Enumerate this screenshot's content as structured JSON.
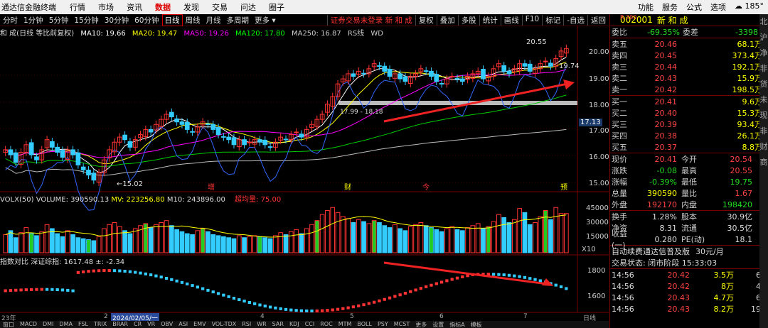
{
  "topbar": {
    "app": "通达信金融终端",
    "menu": [
      "行情",
      "市场",
      "资讯",
      "数据",
      "发现",
      "交易",
      "问达",
      "圈子"
    ],
    "active": "数据",
    "right": [
      "功能",
      "服务",
      "公式",
      "选项"
    ],
    "badge": "185°"
  },
  "periods": [
    "分时",
    "1分钟",
    "5分钟",
    "15分钟",
    "30分钟",
    "60分钟",
    "日线",
    "周线",
    "月线",
    "多周期",
    "更多"
  ],
  "active_period": "日线",
  "login_text": "证券交易未登录",
  "stock_name_top": "新 和 成",
  "tools": [
    "复权",
    "叠加",
    "多股",
    "统计",
    "画线",
    "F10",
    "标记",
    "-自选",
    "返回"
  ],
  "mainline": {
    "title": "和 成(日线 等比前复权)",
    "ma": [
      {
        "label": "MA10: 19.66",
        "color": "#ffffff"
      },
      {
        "label": "MA20: 19.47",
        "color": "#ffff00"
      },
      {
        "label": "MA50: 19.26",
        "color": "#ff00ff"
      },
      {
        "label": "MA120: 17.80",
        "color": "#00ff00"
      },
      {
        "label": "MA250: 16.87",
        "color": "#cccccc"
      }
    ],
    "extra": [
      "RS线",
      "WD"
    ]
  },
  "price_axis": [
    "20.00",
    "19.00",
    "18.00",
    "17.13",
    "17.00",
    "16.00",
    "15.00"
  ],
  "annotations": {
    "high": "20.55",
    "low": "15.02",
    "last": "19.74",
    "range": "17.99 - 18.18"
  },
  "markers": [
    "增",
    "财",
    "今",
    "预"
  ],
  "volume": {
    "title": "VOLX(50)",
    "vol": "VOLUME: 390590.13",
    "mv": "MV: 223256.80",
    "m10": "M10: 243896.00",
    "extra": "超均量: 75.00",
    "axis": [
      "45000",
      "30000",
      "15000",
      "X10"
    ]
  },
  "index": {
    "title": "指数对比",
    "name": "深证综指: 1617.48",
    "chg": "±: -2.34",
    "axis": [
      "1800",
      "1600"
    ]
  },
  "dates": [
    "23年",
    "2",
    "2024/02/05/一",
    "4",
    "5",
    "6",
    "7",
    "日线"
  ],
  "bottom_tabs": [
    "窗口",
    "MACD",
    "DMI",
    "DMA",
    "FSL",
    "TRIX",
    "BRAR",
    "CR",
    "VR",
    "OBV",
    "ASI",
    "EMV",
    "VOL-TDX",
    "RSI",
    "WR",
    "SAR",
    "KDJ",
    "CCI",
    "ROC",
    "MTM",
    "BOLL",
    "PSY",
    "MCST",
    "更多",
    "设置",
    "指标A",
    "模板"
  ],
  "quote": {
    "code": "002001",
    "name": "新 和 成",
    "corner": "R 300",
    "weibi": {
      "label": "委比",
      "value": "-69.35%",
      "label2": "委差",
      "value2": "-3398"
    },
    "sells": [
      {
        "label": "卖五",
        "price": "20.46",
        "vol": "68.1万"
      },
      {
        "label": "卖四",
        "price": "20.45",
        "vol": "373.4万"
      },
      {
        "label": "卖三",
        "price": "20.44",
        "vol": "192.1万"
      },
      {
        "label": "卖二",
        "price": "20.43",
        "vol": "15.9万"
      },
      {
        "label": "卖一",
        "price": "20.42",
        "vol": "198.5万"
      }
    ],
    "buys": [
      {
        "label": "买一",
        "price": "20.41",
        "vol": "9.6万"
      },
      {
        "label": "买二",
        "price": "20.40",
        "vol": "15.3万"
      },
      {
        "label": "买三",
        "price": "20.39",
        "vol": "93.4万"
      },
      {
        "label": "买四",
        "price": "20.38",
        "vol": "26.1万"
      },
      {
        "label": "买五",
        "price": "20.37",
        "vol": "8.8万"
      }
    ],
    "stats": [
      {
        "l1": "现价",
        "v1": "20.41",
        "l2": "今开",
        "v2": "20.54",
        "c1": "red",
        "c2": "red"
      },
      {
        "l1": "涨跌",
        "v1": "-0.08",
        "l2": "最高",
        "v2": "20.55",
        "c1": "green",
        "c2": "red"
      },
      {
        "l1": "涨幅",
        "v1": "-0.39%",
        "l2": "最低",
        "v2": "19.75",
        "c1": "green",
        "c2": "green"
      },
      {
        "l1": "总量",
        "v1": "390590",
        "l2": "量比",
        "v2": "1.67",
        "c1": "yel",
        "c2": "red"
      },
      {
        "l1": "外盘",
        "v1": "192170",
        "l2": "内盘",
        "v2": "198420",
        "c1": "red",
        "c2": "green"
      }
    ],
    "stats2": [
      {
        "l1": "换手",
        "v1": "1.28%",
        "l2": "股本",
        "v2": "30.9亿"
      },
      {
        "l1": "净资",
        "v1": "8.31",
        "l2": "流通",
        "v2": "30.5亿"
      },
      {
        "l1": "收益(一)",
        "v1": "0.280",
        "l2": "PE(动)",
        "v2": "18.1"
      }
    ],
    "promo": "自动续费通达信普及版",
    "promo_price": "30元/月",
    "status": "交易状态: 闭市阶段 15:33:03",
    "ticks": [
      {
        "t": "14:56",
        "p": "20.42",
        "v": "3.5万",
        "n": "6"
      },
      {
        "t": "14:56",
        "p": "20.42",
        "v": "8万",
        "n": "4"
      },
      {
        "t": "14:56",
        "p": "20.43",
        "v": "4.7万",
        "n": "6"
      },
      {
        "t": "14:56",
        "p": "20.43",
        "v": "8.2万",
        "n": "19"
      }
    ]
  },
  "right_edge": [
    "北",
    "沪",
    "净",
    "非",
    "货",
    "未",
    "现",
    "非",
    "财",
    "商"
  ],
  "chart_data": {
    "type": "candlestick",
    "title": "",
    "ylim": [
      14.8,
      20.8
    ],
    "note": "daily candles, approximate values",
    "closes": [
      16.4,
      16.2,
      15.9,
      16.3,
      16.6,
      16.2,
      16.0,
      16.4,
      16.8,
      16.5,
      16.3,
      16.1,
      16.4,
      16.2,
      15.8,
      15.6,
      15.4,
      15.2,
      15.5,
      16.0,
      16.4,
      16.7,
      16.9,
      16.8,
      16.5,
      16.8,
      17.0,
      17.2,
      17.1,
      17.4,
      17.6,
      17.8,
      17.7,
      17.5,
      17.4,
      17.2,
      17.1,
      17.3,
      17.5,
      17.4,
      17.2,
      17.0,
      16.9,
      16.8,
      16.6,
      16.8,
      16.6,
      16.7,
      16.8,
      16.7,
      16.6,
      16.5,
      16.7,
      16.9,
      16.8,
      17.0,
      17.1,
      16.9,
      17.2,
      17.4,
      17.6,
      17.8,
      18.2,
      18.5,
      19.0,
      19.2,
      19.4,
      19.3,
      19.5,
      19.4,
      19.6,
      19.8,
      19.7,
      19.5,
      19.3,
      19.4,
      19.2,
      19.1,
      19.3,
      19.4,
      19.6,
      19.5,
      19.3,
      19.1,
      19.0,
      19.2,
      19.3,
      19.2,
      19.1,
      19.3,
      19.4,
      19.5,
      19.2,
      19.3,
      19.6,
      19.8,
      19.5,
      19.4,
      19.6,
      19.8,
      19.7,
      19.5,
      19.6,
      19.8,
      19.9,
      19.7,
      20.0,
      20.3,
      20.4
    ],
    "volumes": [
      18,
      22,
      15,
      20,
      25,
      19,
      17,
      21,
      28,
      24,
      19,
      16,
      22,
      18,
      15,
      14,
      13,
      12,
      16,
      24,
      28,
      30,
      26,
      22,
      19,
      24,
      27,
      29,
      25,
      28,
      30,
      32,
      27,
      23,
      21,
      19,
      18,
      22,
      24,
      21,
      18,
      17,
      16,
      15,
      14,
      17,
      15,
      16,
      17,
      16,
      15,
      14,
      17,
      20,
      18,
      21,
      23,
      19,
      24,
      28,
      32,
      38,
      42,
      45,
      40,
      36,
      34,
      30,
      33,
      31,
      29,
      32,
      30,
      27,
      25,
      28,
      24,
      22,
      26,
      28,
      30,
      27,
      25,
      23,
      21,
      24,
      26,
      23,
      22,
      25,
      27,
      29,
      24,
      26,
      31,
      38,
      35,
      30,
      33,
      44,
      40,
      28,
      30,
      36,
      42,
      33,
      45,
      39,
      39
    ]
  }
}
